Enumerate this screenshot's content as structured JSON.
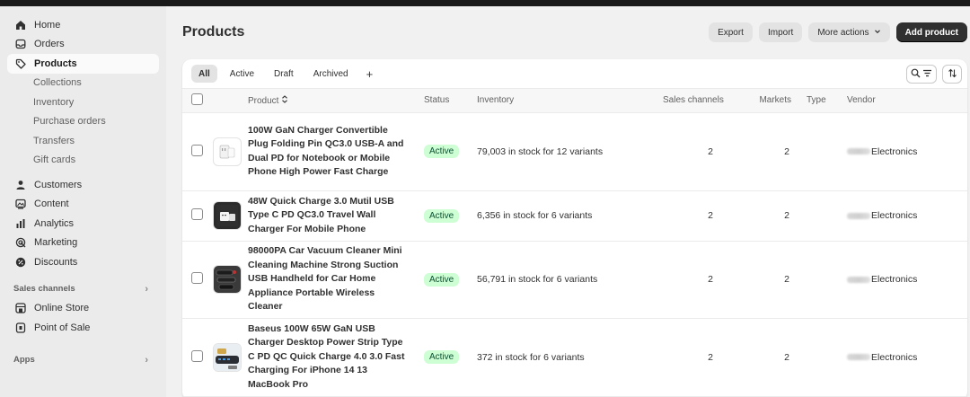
{
  "sidebar": {
    "items": [
      {
        "label": "Home",
        "icon": "home-icon"
      },
      {
        "label": "Orders",
        "icon": "inbox-icon"
      },
      {
        "label": "Products",
        "icon": "tag-icon",
        "active": true
      }
    ],
    "product_subitems": [
      "Collections",
      "Inventory",
      "Purchase orders",
      "Transfers",
      "Gift cards"
    ],
    "items2": [
      {
        "label": "Customers",
        "icon": "person-icon"
      },
      {
        "label": "Content",
        "icon": "content-icon"
      },
      {
        "label": "Analytics",
        "icon": "bar-chart-icon"
      },
      {
        "label": "Marketing",
        "icon": "target-icon"
      },
      {
        "label": "Discounts",
        "icon": "discount-icon"
      }
    ],
    "sales_channels_label": "Sales channels",
    "channels": [
      {
        "label": "Online Store",
        "icon": "store-icon"
      },
      {
        "label": "Point of Sale",
        "icon": "pos-icon"
      }
    ],
    "apps_label": "Apps"
  },
  "header": {
    "title": "Products",
    "export_label": "Export",
    "import_label": "Import",
    "more_actions_label": "More actions",
    "add_product_label": "Add product"
  },
  "tabs": [
    "All",
    "Active",
    "Draft",
    "Archived"
  ],
  "tab_add": "+",
  "table": {
    "headers": {
      "product": "Product",
      "status": "Status",
      "inventory": "Inventory",
      "sales_channels": "Sales channels",
      "markets": "Markets",
      "type": "Type",
      "vendor": "Vendor"
    },
    "rows": [
      {
        "name": "100W GaN Charger Convertible Plug Folding Pin QC3.0 USB-A and Dual PD for Notebook or Mobile Phone High Power Fast Charge",
        "status": "Active",
        "inventory": "79,003 in stock for 12 variants",
        "sales_channels": "2",
        "markets": "2",
        "type": "",
        "vendor": "Electronics",
        "thumb": "charger-white"
      },
      {
        "name": "48W Quick Charge 3.0 Mutil USB Type C PD QC3.0 Travel Wall Charger For Mobile Phone",
        "status": "Active",
        "inventory": "6,356 in stock for 6 variants",
        "sales_channels": "2",
        "markets": "2",
        "type": "",
        "vendor": "Electronics",
        "thumb": "charger-box"
      },
      {
        "name": "98000PA Car Vacuum Cleaner Mini Cleaning Machine Strong Suction USB Handheld for Car Home Appliance Portable Wireless Cleaner",
        "status": "Active",
        "inventory": "56,791 in stock for 6 variants",
        "sales_channels": "2",
        "markets": "2",
        "type": "",
        "vendor": "Electronics",
        "thumb": "vacuum"
      },
      {
        "name": "Baseus 100W 65W GaN USB Charger Desktop Power Strip Type C PD QC Quick Charge 4.0 3.0 Fast Charging For iPhone 14 13 MacBook Pro",
        "status": "Active",
        "inventory": "372 in stock for 6 variants",
        "sales_channels": "2",
        "markets": "2",
        "type": "",
        "vendor": "Electronics",
        "thumb": "power-strip"
      }
    ]
  },
  "colors": {
    "active_badge_bg": "#cdfed4",
    "active_badge_text": "#0c5132",
    "primary_button": "#303030",
    "sidebar_bg": "#ebebeb",
    "page_bg": "#f1f1f1"
  }
}
